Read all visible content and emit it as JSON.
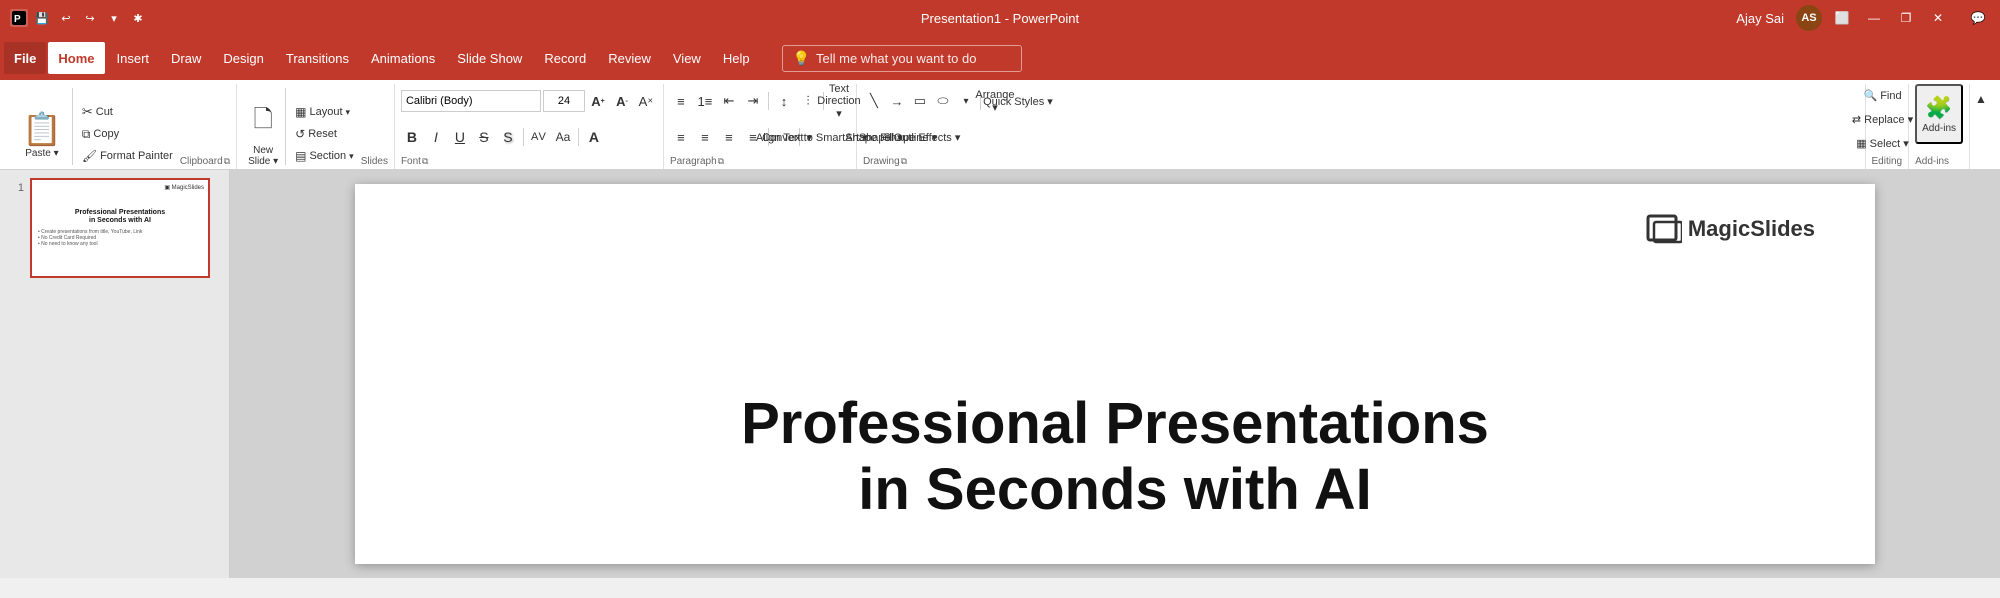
{
  "titlebar": {
    "quickaccess": {
      "save": "💾",
      "undo": "↩",
      "redo": "↪",
      "customize": "▼",
      "extra": "✱"
    },
    "title": "Presentation1  -  PowerPoint",
    "user": {
      "name": "Ajay Sai",
      "initials": "AS"
    },
    "buttons": {
      "ribbon": "⬜",
      "minimize": "—",
      "restore": "❐",
      "close": "✕",
      "chat": "💬"
    }
  },
  "menubar": {
    "items": [
      {
        "id": "file",
        "label": "File",
        "active": false,
        "file": true
      },
      {
        "id": "home",
        "label": "Home",
        "active": true
      },
      {
        "id": "insert",
        "label": "Insert"
      },
      {
        "id": "draw",
        "label": "Draw"
      },
      {
        "id": "design",
        "label": "Design"
      },
      {
        "id": "transitions",
        "label": "Transitions"
      },
      {
        "id": "animations",
        "label": "Animations"
      },
      {
        "id": "slideshow",
        "label": "Slide Show"
      },
      {
        "id": "record",
        "label": "Record"
      },
      {
        "id": "review",
        "label": "Review"
      },
      {
        "id": "view",
        "label": "View"
      },
      {
        "id": "help",
        "label": "Help"
      }
    ],
    "tellme": {
      "icon": "💡",
      "placeholder": "Tell me what you want to do"
    }
  },
  "ribbon": {
    "groups": {
      "clipboard": {
        "label": "Clipboard",
        "paste_label": "Paste",
        "cut_label": "Cut",
        "copy_label": "Copy",
        "format_painter_label": "Format Painter"
      },
      "slides": {
        "label": "Slides",
        "new_slide_label": "New Slide",
        "layout_label": "Layout",
        "reset_label": "Reset",
        "section_label": "Section"
      },
      "font": {
        "label": "Font",
        "font_name": "Calibri (Body)",
        "font_size": "24",
        "bold": "B",
        "italic": "I",
        "underline": "U",
        "strikethrough": "S",
        "shadow": "S",
        "char_spacing": "AV",
        "font_color": "A",
        "increase_size": "A↑",
        "decrease_size": "A↓",
        "clear_format": "A✕",
        "change_case": "Aa"
      },
      "paragraph": {
        "label": "Paragraph",
        "bullets_label": "Bullets",
        "numbering_label": "Numbering",
        "decrease_indent_label": "Decrease Indent",
        "increase_indent_label": "Increase Indent",
        "line_spacing_label": "Line Spacing",
        "columns_label": "Columns",
        "text_direction_label": "Text Direction",
        "align_text_label": "Align Text",
        "convert_smartart_label": "Convert to SmartArt",
        "align_left": "≡",
        "align_center": "≡",
        "align_right": "≡",
        "justify": "≡"
      },
      "drawing": {
        "label": "Drawing",
        "arrange_label": "Arrange",
        "quick_styles_label": "Quick Styles",
        "shape_fill_label": "Shape Fill",
        "shape_outline_label": "Shape Outline",
        "shape_effects_label": "Shape Effects"
      },
      "editing": {
        "label": "Editing",
        "find_label": "Find",
        "replace_label": "Replace",
        "select_label": "Select"
      },
      "addins": {
        "label": "Add-ins"
      }
    }
  },
  "slides": [
    {
      "num": "1",
      "title": "Professional Presentations\nin Seconds with AI",
      "bullets": "• Create presentations from title, YouTube, Link\n• No Credit Card Required\n• No need to know any tool"
    }
  ],
  "canvas": {
    "logo_icon": "▣",
    "logo_text": "MagicSlides",
    "main_title_line1": "Professional Presentations",
    "main_title_line2": "in Seconds with AI"
  },
  "arrow": {
    "visible": true
  }
}
